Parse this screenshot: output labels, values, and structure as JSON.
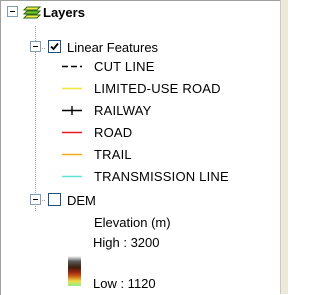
{
  "tree": {
    "root": {
      "label": "Layers",
      "icon": "layers-icon"
    },
    "linear_features": {
      "label": "Linear Features",
      "checked": true,
      "legend": [
        {
          "label": "CUT LINE",
          "symbol": "dashed-line",
          "color": "#000000"
        },
        {
          "label": "LIMITED-USE ROAD",
          "symbol": "solid-line",
          "color": "#f0e63a"
        },
        {
          "label": "RAILWAY",
          "symbol": "railway-line",
          "color": "#000000"
        },
        {
          "label": "ROAD",
          "symbol": "solid-line",
          "color": "#e61e1e"
        },
        {
          "label": "TRAIL",
          "symbol": "solid-line",
          "color": "#f5a81e"
        },
        {
          "label": "TRANSMISSION LINE",
          "symbol": "solid-line",
          "color": "#5ce6d2"
        }
      ]
    },
    "dem": {
      "label": "DEM",
      "checked": false,
      "field_label": "Elevation (m)",
      "high_label": "High : 3200",
      "low_label": "Low : 1120",
      "ramp_colors": [
        "#ffffff",
        "#5a5a5a",
        "#3c1e0a",
        "#a02814",
        "#c86414",
        "#f0dc46",
        "#8cf08c"
      ]
    }
  }
}
